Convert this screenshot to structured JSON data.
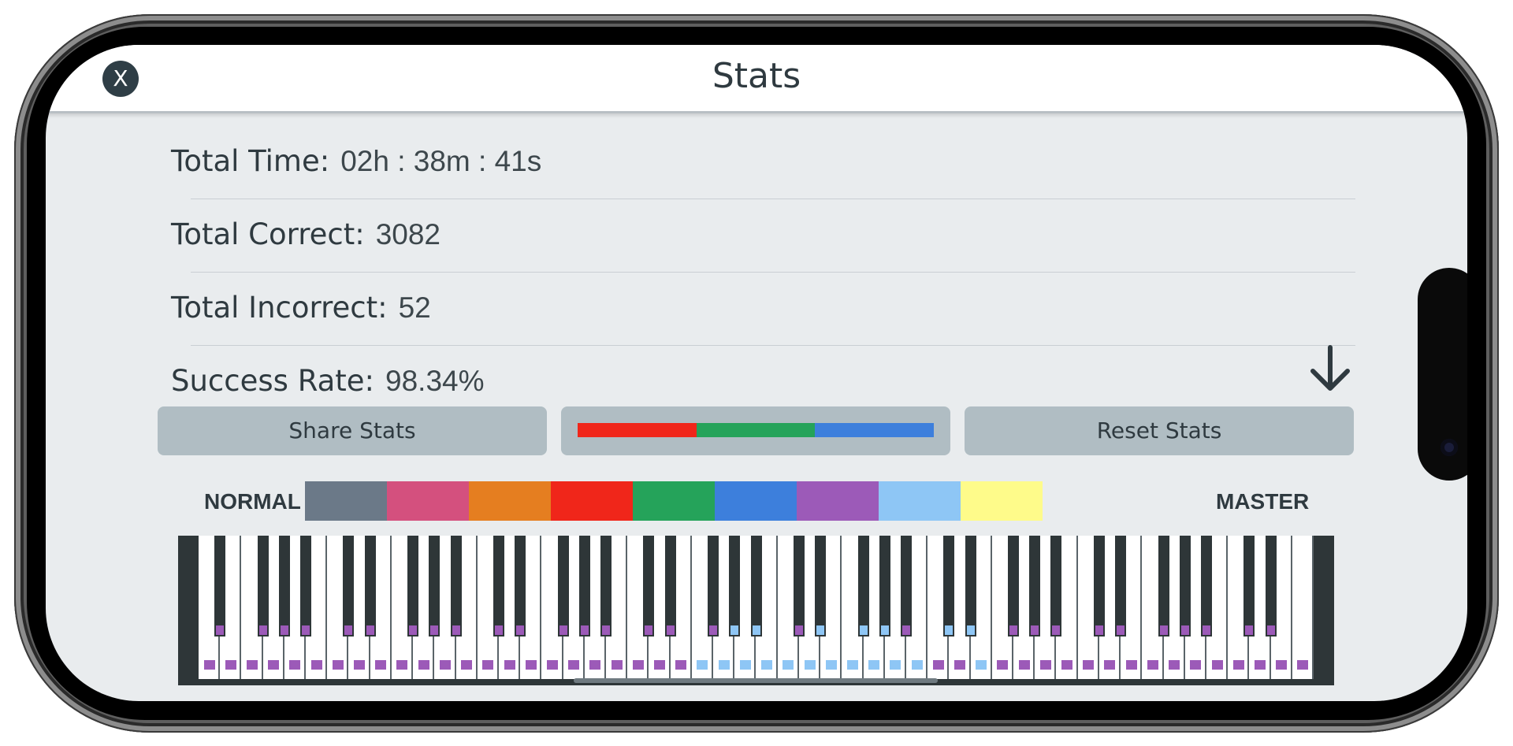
{
  "header": {
    "title": "Stats",
    "close_label": "X"
  },
  "stats": [
    {
      "label": "Total Time:",
      "value": "02h : 38m : 41s"
    },
    {
      "label": "Total Correct:",
      "value": "3082"
    },
    {
      "label": "Total Incorrect:",
      "value": "52"
    },
    {
      "label": "Success Rate:",
      "value": "98.34%"
    }
  ],
  "buttons": {
    "share_label": "Share Stats",
    "reset_label": "Reset Stats"
  },
  "progress": {
    "segments": [
      {
        "color": "#f0261a",
        "fraction": 0.333
      },
      {
        "color": "#25a35a",
        "fraction": 0.333
      },
      {
        "color": "#3d7fdc",
        "fraction": 0.334
      }
    ]
  },
  "level": {
    "left_label": "NORMAL",
    "right_label": "MASTER",
    "colors": [
      "#6b7988",
      "#d4507e",
      "#e57e20",
      "#f0261a",
      "#25a35a",
      "#3d7fdc",
      "#9c5ab8",
      "#8ec6f5",
      "#fefb8a"
    ]
  },
  "icons": {
    "scroll": "down-arrow-icon",
    "close": "close-icon"
  },
  "keyboard": {
    "white_keys": 52,
    "octave_start_offset": 1
  }
}
